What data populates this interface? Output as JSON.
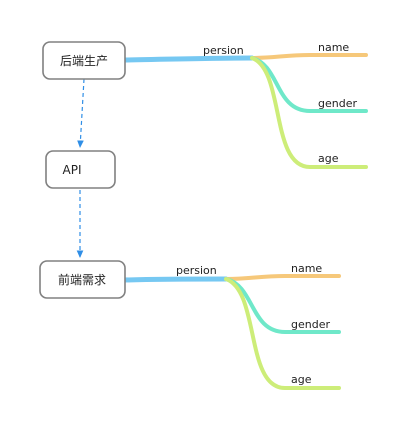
{
  "nodes": {
    "backend": {
      "label": "后端生产"
    },
    "api": {
      "label": "API"
    },
    "frontend": {
      "label": "前端需求"
    }
  },
  "trees": {
    "top": {
      "root_label": "persion",
      "branches": [
        {
          "label": "name",
          "color": "#F6C87A"
        },
        {
          "label": "gender",
          "color": "#6FE8C9"
        },
        {
          "label": "age",
          "color": "#CDED79"
        }
      ],
      "trunk_color": "#76C8F2"
    },
    "bottom": {
      "root_label": "persion",
      "branches": [
        {
          "label": "name",
          "color": "#F6C87A"
        },
        {
          "label": "gender",
          "color": "#6FE8C9"
        },
        {
          "label": "age",
          "color": "#CDED79"
        }
      ],
      "trunk_color": "#76C8F2"
    }
  },
  "colors": {
    "box_border": "#808080",
    "arrow": "#2F8EE6"
  }
}
